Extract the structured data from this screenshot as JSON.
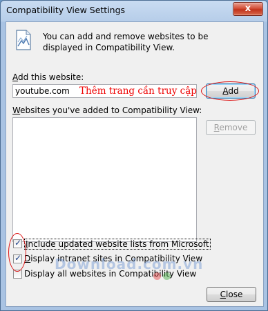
{
  "window": {
    "title": "Compatibility View Settings",
    "close_glyph": "x"
  },
  "header": {
    "icon": "compatibility-view-icon",
    "text": "You can add and remove websites to be displayed in Compatibility View."
  },
  "add_section": {
    "label_prefix": "",
    "label_access": "A",
    "label_rest": "dd this website:",
    "input_value": "youtube.com",
    "annotation": "Thêm trang cần truy cập",
    "add_access": "A",
    "add_rest": "dd"
  },
  "list_section": {
    "label_access": "W",
    "label_rest": "ebsites you've added to Compatibility View:",
    "items": [],
    "remove_access": "R",
    "remove_rest": "emove"
  },
  "checkboxes": [
    {
      "access": "I",
      "rest": "nclude updated website lists from Microsoft",
      "checked": true
    },
    {
      "access": "D",
      "rest": "isplay intranet sites in Compatibility View",
      "checked": true
    },
    {
      "access": "",
      "rest": "Display all websites in Compatibility View",
      "checked": false
    }
  ],
  "watermark": "Download.com.vn",
  "footer": {
    "close_access": "C",
    "close_rest": "lose"
  },
  "colors": {
    "annotation_red": "#e00000",
    "check_blue": "#1a3f87"
  }
}
